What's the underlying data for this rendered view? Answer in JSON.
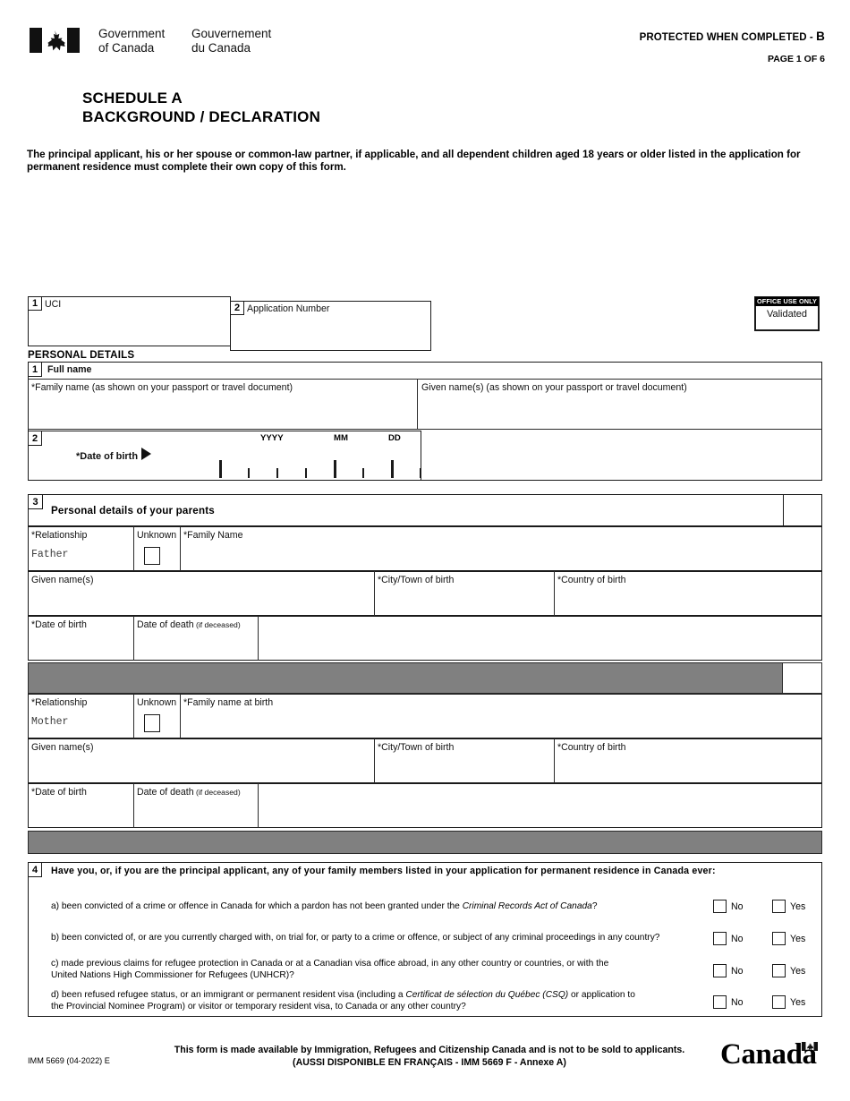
{
  "header": {
    "wordmark_gov_en_line1": "Government",
    "wordmark_gov_en_line2": "of Canada",
    "wordmark_gov_fr_line1": "Gouvernement",
    "wordmark_gov_fr_line2": "du Canada",
    "protected_label": "PROTECTED WHEN COMPLETED -",
    "protected_level": "B",
    "page_number": "PAGE 1 OF 6"
  },
  "title": {
    "line1": "SCHEDULE A",
    "line2": "BACKGROUND / DECLARATION"
  },
  "intro": "The principal applicant, his or her spouse or common-law partner, if applicable, and all dependent children aged 18 years or older listed in the application for permanent residence must complete their own copy of this form.",
  "identifiers": {
    "uci": {
      "number": "1",
      "label": "UCI",
      "value": ""
    },
    "application_number": {
      "number": "2",
      "label": "Application Number",
      "value": ""
    }
  },
  "office_use": {
    "header": "OFFICE USE ONLY",
    "status": "Validated"
  },
  "personal_details": {
    "section_heading": "PERSONAL DETAILS",
    "full_name": {
      "number": "1",
      "label": "Full name",
      "family_name_label": "*Family name  (as shown on your passport or travel document)",
      "family_name_value": "",
      "given_name_label": "Given name(s)  (as shown on your passport or travel document)",
      "given_name_value": ""
    },
    "date_of_birth": {
      "number": "2",
      "label": "*Date of birth",
      "yyyy": "YYYY",
      "mm": "MM",
      "dd": "DD",
      "value": ""
    }
  },
  "parents": {
    "number": "3",
    "heading": "Personal details of your parents",
    "entries": [
      {
        "relationship_label": "*Relationship",
        "relationship_value": "Father",
        "unknown_label": "Unknown",
        "unknown_checked": false,
        "family_name_label": "*Family Name",
        "family_name_value": "",
        "given_names_label": "Given name(s)",
        "given_names_value": "",
        "city_label": "*City/Town of birth",
        "city_value": "",
        "country_label": "*Country of birth",
        "country_value": "",
        "dob_label": "*Date of birth",
        "dob_value": "",
        "dod_label": "Date of death",
        "dod_label_suffix": "(if deceased)",
        "dod_value": ""
      },
      {
        "relationship_label": "*Relationship",
        "relationship_value": "Mother",
        "unknown_label": "Unknown",
        "unknown_checked": false,
        "family_name_label": "*Family name at birth",
        "family_name_value": "",
        "given_names_label": "Given name(s)",
        "given_names_value": "",
        "city_label": "*City/Town of birth",
        "city_value": "",
        "country_label": "*Country of birth",
        "country_value": "",
        "dob_label": "*Date of birth",
        "dob_value": "",
        "dod_label": "Date of death",
        "dod_label_suffix": "(if deceased)",
        "dod_value": ""
      }
    ]
  },
  "question4": {
    "number": "4",
    "heading": "Have you, or, if you are the principal applicant, any of your family members listed in your application for permanent residence in Canada ever:",
    "no_label": "No",
    "yes_label": "Yes",
    "items": [
      {
        "id": "a",
        "line1_pre": "a) been convicted of a crime or offence in Canada for which a pardon has not been granted under the ",
        "line1_em": "Criminal Records Act of Canada",
        "line1_post": "?",
        "line2_pre": "",
        "line2_em": "",
        "line2_post": "",
        "no_checked": false,
        "yes_checked": false
      },
      {
        "id": "b",
        "line1_pre": "b) been convicted of, or are you currently charged with, on trial for, or party to a crime or offence, or subject of any criminal proceedings in any country?",
        "line1_em": "",
        "line1_post": "",
        "line2_pre": "",
        "line2_em": "",
        "line2_post": "",
        "no_checked": false,
        "yes_checked": false
      },
      {
        "id": "c",
        "line1_pre": "c) made previous claims for refugee protection in Canada or at a Canadian visa office abroad, in any other country or countries, or with the",
        "line1_em": "",
        "line1_post": "",
        "line2_pre": "United Nations High Commissioner for Refugees (UNHCR)?",
        "line2_em": "",
        "line2_post": "",
        "no_checked": false,
        "yes_checked": false
      },
      {
        "id": "d",
        "line1_pre": "d) been refused refugee status, or an immigrant or permanent resident visa (including a ",
        "line1_em": "Certificat de sélection du Québec (CSQ)",
        "line1_post": " or application to",
        "line2_pre": "the Provincial Nominee Program) or visitor or temporary resident visa, to Canada or any other country?",
        "line2_em": "",
        "line2_post": "",
        "no_checked": false,
        "yes_checked": false
      }
    ]
  },
  "footer": {
    "notice_line1": "This form is made available by Immigration, Refugees and Citizenship Canada and is not to be sold to applicants.",
    "notice_line2": "(AUSSI DISPONIBLE EN FRANÇAIS - IMM 5669 F - Annexe A)",
    "form_code": "IMM 5669 (04-2022) E",
    "wordmark": "Canada"
  },
  "colors": {
    "ink": "#111111",
    "rule": "#2a2a2a",
    "shade_bar": "#808080",
    "office_header_bg": "#000000",
    "paper": "#ffffff"
  }
}
